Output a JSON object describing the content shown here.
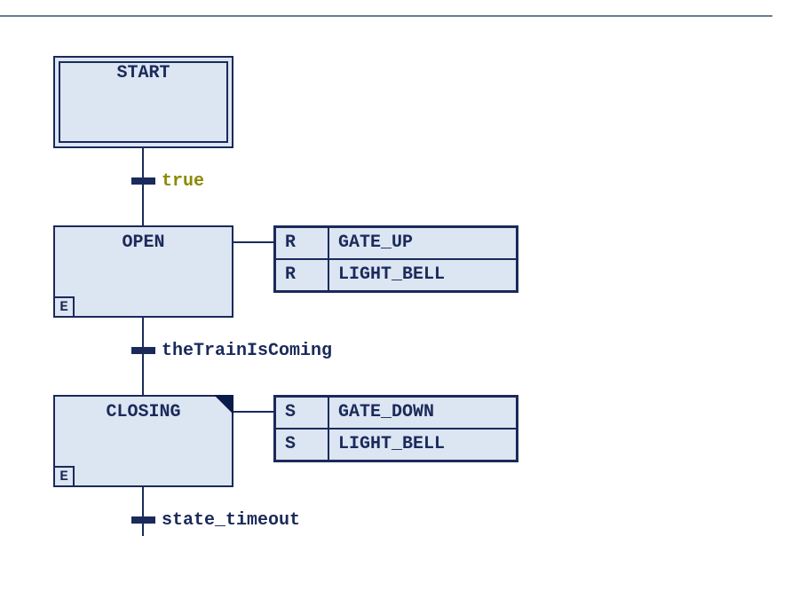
{
  "steps": {
    "start": {
      "label": "START"
    },
    "open": {
      "label": "OPEN",
      "qualifier": "E"
    },
    "closing": {
      "label": "CLOSING",
      "qualifier": "E"
    }
  },
  "transitions": {
    "t1": {
      "label": "true"
    },
    "t2": {
      "label": "theTrainIsComing"
    },
    "t3": {
      "label": "state_timeout"
    }
  },
  "actions": {
    "open": [
      {
        "qualifier": "R",
        "name": "GATE_UP"
      },
      {
        "qualifier": "R",
        "name": "LIGHT_BELL"
      }
    ],
    "closing": [
      {
        "qualifier": "S",
        "name": "GATE_DOWN"
      },
      {
        "qualifier": "S",
        "name": "LIGHT_BELL"
      }
    ]
  }
}
